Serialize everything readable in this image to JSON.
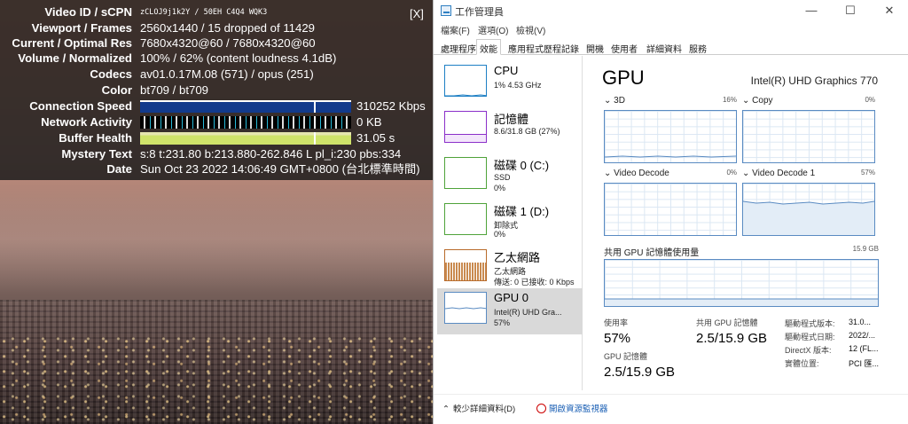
{
  "stats": {
    "close_label": "[X]",
    "rows": [
      {
        "label": "Video ID / sCPN",
        "value": "zCLOJ9j1k2Y / 50EH C4Q4 WQK3"
      },
      {
        "label": "Viewport / Frames",
        "value": "2560x1440 / 15 dropped of 11429"
      },
      {
        "label": "Current / Optimal Res",
        "value": "7680x4320@60 / 7680x4320@60"
      },
      {
        "label": "Volume / Normalized",
        "value": "100% / 62% (content loudness 4.1dB)"
      },
      {
        "label": "Codecs",
        "value": "av01.0.17M.08 (571) / opus (251)"
      },
      {
        "label": "Color",
        "value": "bt709 / bt709"
      },
      {
        "label": "Connection Speed",
        "value": "310252 Kbps"
      },
      {
        "label": "Network Activity",
        "value": "0 KB"
      },
      {
        "label": "Buffer Health",
        "value": "31.05 s"
      },
      {
        "label": "Mystery Text",
        "value": "s:8 t:231.80 b:213.880-262.846 L pl_i:230 pbs:334"
      },
      {
        "label": "Date",
        "value": "Sun Oct 23 2022 14:06:49 GMT+0800 (台北標準時間)"
      }
    ]
  },
  "taskmgr": {
    "title": "工作管理員",
    "menu": [
      "檔案(F)",
      "選項(O)",
      "檢視(V)"
    ],
    "tabs": [
      "處理程序",
      "效能",
      "應用程式歷程記錄",
      "開機",
      "使用者",
      "詳細資料",
      "服務"
    ],
    "active_tab": "效能",
    "resources": [
      {
        "name": "CPU",
        "sub1": "1% 4.53 GHz",
        "sub2": "",
        "color": "#1d7fc4"
      },
      {
        "name": "記憶體",
        "sub1": "8.6/31.8 GB (27%)",
        "sub2": "",
        "color": "#8b2fc9"
      },
      {
        "name": "磁碟 0 (C:)",
        "sub1": "SSD",
        "sub2": "0%",
        "color": "#4fa33a"
      },
      {
        "name": "磁碟 1 (D:)",
        "sub1": "卸除式",
        "sub2": "0%",
        "color": "#4fa33a"
      },
      {
        "name": "乙太網路",
        "sub1": "乙太網路",
        "sub2": "傳送: 0 已接收: 0 Kbps",
        "color": "#b86b2a"
      },
      {
        "name": "GPU 0",
        "sub1": "Intel(R) UHD Gra...",
        "sub2": "57%",
        "color": "#5a8bc2"
      }
    ],
    "gpu": {
      "title": "GPU",
      "name": "Intel(R) UHD Graphics 770",
      "engines": [
        {
          "label": "3D",
          "pct": "16%"
        },
        {
          "label": "Copy",
          "pct": "0%"
        },
        {
          "label": "Video Decode",
          "pct": "0%"
        },
        {
          "label": "Video Decode 1",
          "pct": "57%"
        }
      ],
      "shared_mem_label": "共用 GPU 記憶體使用量",
      "shared_mem_max": "15.9 GB",
      "utilization_label": "使用率",
      "utilization": "57%",
      "shared_gpu_mem_label": "共用 GPU 記憶體",
      "shared_gpu_mem": "2.5/15.9 GB",
      "gpu_mem_label": "GPU 記憶體",
      "gpu_mem": "2.5/15.9 GB",
      "driver_version_label": "驅動程式版本:",
      "driver_version": "31.0...",
      "driver_date_label": "驅動程式日期:",
      "driver_date": "2022/...",
      "directx_label": "DirectX 版本:",
      "directx": "12 (FL...",
      "location_label": "實體位置:",
      "location": "PCI 匯..."
    },
    "footer": {
      "less_label": "較少詳細資料(D)",
      "monitor_label": "開啟資源監視器"
    }
  }
}
